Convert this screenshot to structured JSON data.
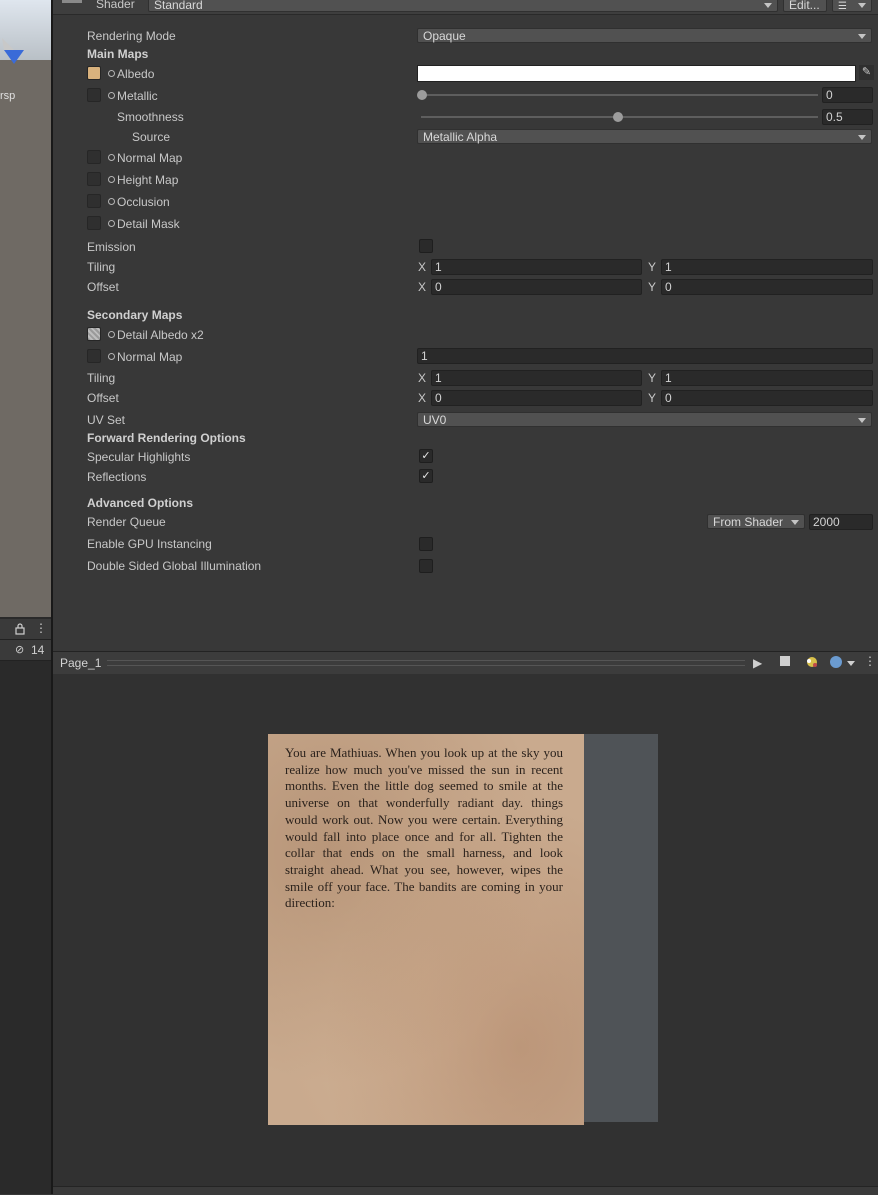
{
  "scene_view": {
    "label_fragment": "rsp"
  },
  "hierarchy_toolbar": {
    "hidden_count": "14"
  },
  "shader_row": {
    "label": "Shader",
    "value": "Standard",
    "edit_label": "Edit..."
  },
  "material": {
    "rendering_mode": {
      "label": "Rendering Mode",
      "value": "Opaque"
    },
    "main_maps": {
      "header": "Main Maps",
      "albedo": "Albedo",
      "metallic": {
        "label": "Metallic",
        "value": "0",
        "slider_fraction": 0
      },
      "smoothness": {
        "label": "Smoothness",
        "value": "0.5",
        "slider_fraction": 0.5
      },
      "source": {
        "label": "Source",
        "value": "Metallic Alpha"
      },
      "normal_map": "Normal Map",
      "height_map": "Height Map",
      "occlusion": "Occlusion",
      "detail_mask": "Detail Mask",
      "emission": "Emission",
      "tiling": {
        "label": "Tiling",
        "x": "1",
        "y": "1"
      },
      "offset": {
        "label": "Offset",
        "x": "0",
        "y": "0"
      }
    },
    "secondary_maps": {
      "header": "Secondary Maps",
      "detail_albedo": "Detail Albedo x2",
      "normal_map": {
        "label": "Normal Map",
        "value": "1"
      },
      "tiling": {
        "label": "Tiling",
        "x": "1",
        "y": "1"
      },
      "offset": {
        "label": "Offset",
        "x": "0",
        "y": "0"
      },
      "uv_set": {
        "label": "UV Set",
        "value": "UV0"
      }
    },
    "forward_rendering": {
      "header": "Forward Rendering Options",
      "specular_highlights": {
        "label": "Specular Highlights",
        "checked": true
      },
      "reflections": {
        "label": "Reflections",
        "checked": true
      }
    },
    "advanced": {
      "header": "Advanced Options",
      "render_queue": {
        "label": "Render Queue",
        "mode": "From Shader",
        "value": "2000"
      },
      "gpu_instancing": {
        "label": "Enable GPU Instancing",
        "checked": false
      },
      "double_sided_gi": {
        "label": "Double Sided Global Illumination",
        "checked": false
      }
    },
    "axis_x": "X",
    "axis_y": "Y"
  },
  "preview": {
    "title": "Page_1",
    "page_text": "You are Mathiuas. When you look up at the sky you realize how much you've missed the sun in recent months. Even the little dog seemed to smile at the universe on that wonderfully radiant day. things would work out. Now you were certain. Everything would fall into place once and for all. Tighten the collar that ends on the small harness, and look straight ahead. What you see, however, wipes the smile off your face. The bandits are coming in your direction:"
  }
}
